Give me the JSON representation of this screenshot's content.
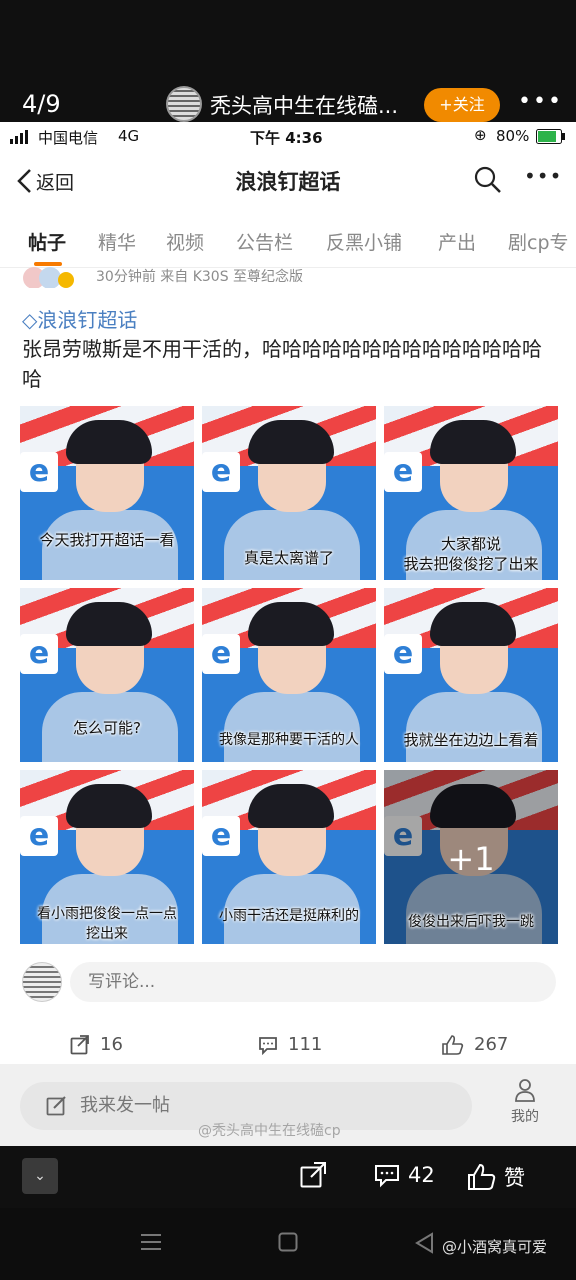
{
  "viewer": {
    "page_counter": "4/9",
    "poster_name": "秃头高中生在线磕...",
    "follow_label": "+关注",
    "more_label": "•••"
  },
  "status_bar": {
    "carrier": "中国电信",
    "network": "4G",
    "time": "下午 4:36",
    "battery": "80%"
  },
  "nav": {
    "back_label": "返回",
    "title": "浪浪钉超话"
  },
  "tabs": [
    "帖子",
    "精华",
    "视频",
    "公告栏",
    "反黑小铺",
    "产出",
    "剧cp专"
  ],
  "post": {
    "meta": "30分钟前  来自 K30S 至尊纪念版",
    "topic": "浪浪钉超话",
    "text": "张昂劳嗷斯是不用干活的，哈哈哈哈哈哈哈哈哈哈哈哈哈哈哈",
    "captions": [
      "今天我打开超话一看",
      "真是太离谱了",
      "大家都说\n我去把俊俊挖了出来",
      "怎么可能?",
      "我像是那种要干活的人",
      "我就坐在边边上看着",
      "看小雨把俊俊一点一点\n挖出来",
      "小雨干活还是挺麻利的",
      "俊俊出来后吓我一跳"
    ],
    "more_count": "+1"
  },
  "comment": {
    "placeholder": "写评论..."
  },
  "actions": {
    "repost": "16",
    "comments": "111",
    "likes": "267"
  },
  "bottom_bar": {
    "compose_label": "我来发一帖",
    "me_label": "我的",
    "watermark": "@秃头高中生在线磕cp"
  },
  "viewer_bottom": {
    "comment_count": "42",
    "like_label": "赞",
    "expand_label": "⌄"
  },
  "android": {
    "watermark": "@小酒窝真可爱"
  }
}
